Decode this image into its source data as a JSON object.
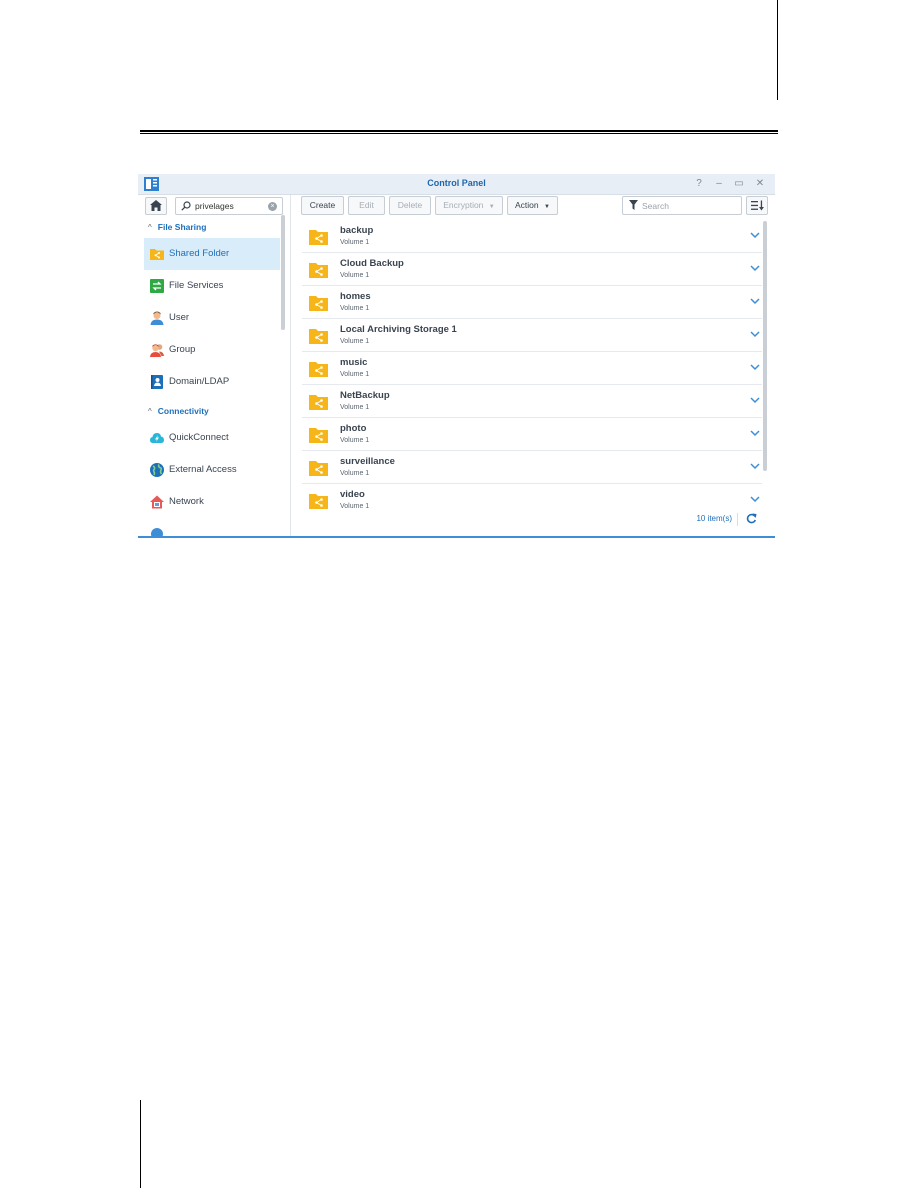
{
  "window": {
    "title": "Control Panel",
    "controls": [
      {
        "name": "help-button",
        "glyph": "?"
      },
      {
        "name": "minimize-button",
        "glyph": "–"
      },
      {
        "name": "maximize-button",
        "glyph": "▭"
      },
      {
        "name": "close-button",
        "glyph": "✕"
      }
    ]
  },
  "sidebar": {
    "search": {
      "value": "privelages",
      "placeholder": ""
    },
    "sections": [
      {
        "label": "File Sharing",
        "caret": "^"
      },
      {
        "label": "Connectivity",
        "caret": "^"
      }
    ],
    "items": [
      {
        "label": "Shared Folder",
        "icon": "shared-folder-icon",
        "active": true
      },
      {
        "label": "File Services",
        "icon": "file-services-icon"
      },
      {
        "label": "User",
        "icon": "user-icon"
      },
      {
        "label": "Group",
        "icon": "group-icon"
      },
      {
        "label": "Domain/LDAP",
        "icon": "domain-ldap-icon"
      },
      {
        "label": "QuickConnect",
        "icon": "quickconnect-icon"
      },
      {
        "label": "External Access",
        "icon": "external-access-icon"
      },
      {
        "label": "Network",
        "icon": "network-icon"
      }
    ]
  },
  "toolbar": {
    "create": "Create",
    "edit": "Edit",
    "delete": "Delete",
    "encryption": "Encryption",
    "action": "Action",
    "search_placeholder": "Search"
  },
  "folders": [
    {
      "name": "backup",
      "volume": "Volume 1"
    },
    {
      "name": "Cloud Backup",
      "volume": "Volume 1"
    },
    {
      "name": "homes",
      "volume": "Volume 1"
    },
    {
      "name": "Local Archiving Storage 1",
      "volume": "Volume 1"
    },
    {
      "name": "music",
      "volume": "Volume 1"
    },
    {
      "name": "NetBackup",
      "volume": "Volume 1"
    },
    {
      "name": "photo",
      "volume": "Volume 1"
    },
    {
      "name": "surveillance",
      "volume": "Volume 1"
    },
    {
      "name": "video",
      "volume": "Volume 1"
    }
  ],
  "footer": {
    "count": "10 item(s)"
  },
  "colors": {
    "accent": "#1e6fba",
    "folder": "#f6b619",
    "active_bg": "#d9ecf9"
  }
}
